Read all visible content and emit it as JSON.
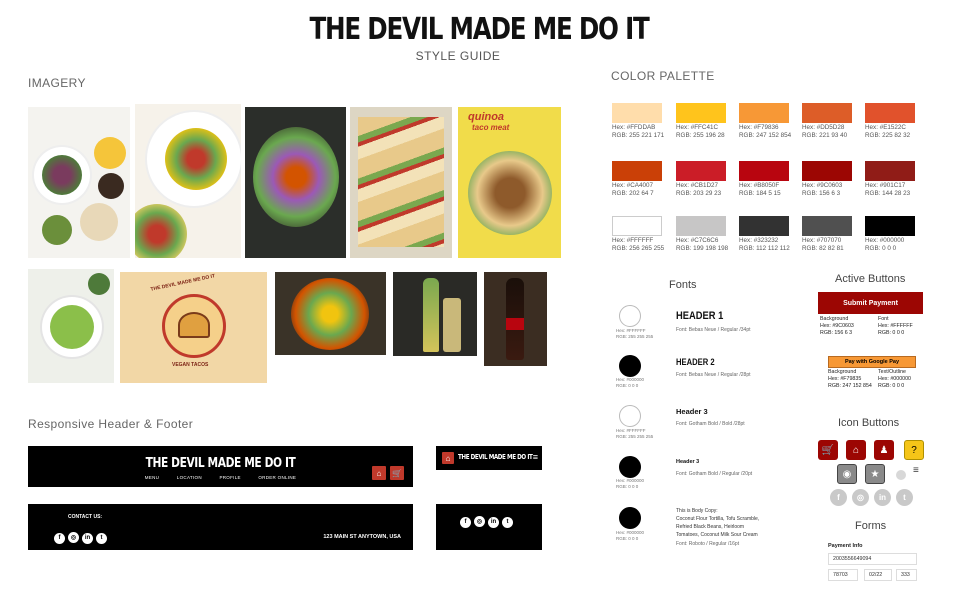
{
  "page": {
    "title": "THE DEVIL MADE ME DO IT",
    "subtitle": "STYLE GUIDE"
  },
  "sections": {
    "imagery": "IMAGERY",
    "responsive": "Responsive Header & Footer",
    "palette": "COLOR PALETTE",
    "fonts": "Fonts",
    "active_buttons": "Active Buttons",
    "icon_buttons": "Icon Buttons",
    "forms": "Forms"
  },
  "imagery": {
    "poster_text_1": "quinoa",
    "poster_text_2": "taco meat",
    "logo_text": "THE DEVIL MADE ME DO IT",
    "logo_sub": "VEGAN TACOS"
  },
  "header_bar": {
    "title": "THE DEVIL MADE ME DO IT",
    "nav": [
      "MENU",
      "LOCATION",
      "PROFILE",
      "ORDER ONLINE"
    ],
    "home_icon": "home-icon",
    "cart_icon": "cart-icon"
  },
  "mobile_header": {
    "title": "THE DEVIL MADE ME DO IT",
    "menu_icon": "hamburger-icon"
  },
  "footer_bar": {
    "contact_label": "CONTACT US:",
    "address": "123 MAIN ST ANYTOWN, USA",
    "social": [
      "f",
      "ig",
      "in",
      "tw"
    ]
  },
  "palette": [
    {
      "hex": "Hex: #FFDDAB",
      "rgb": "RGB: 255 221 171",
      "color": "#FFDDAB"
    },
    {
      "hex": "Hex: #FFC41C",
      "rgb": "RGB: 255 196 28",
      "color": "#FFC41C"
    },
    {
      "hex": "Hex: #F79836",
      "rgb": "RGB: 247 152 854",
      "color": "#F79836"
    },
    {
      "hex": "Hex: #DD5D28",
      "rgb": "RGB: 221 93 40",
      "color": "#DD5D28"
    },
    {
      "hex": "Hex: #E1522C",
      "rgb": "RGB: 225 82 32",
      "color": "#E1522C"
    },
    {
      "hex": "Hex: #CA4007",
      "rgb": "RGB: 202 64 7",
      "color": "#CA4007"
    },
    {
      "hex": "Hex: #CB1D27",
      "rgb": "RGB: 203 29 23",
      "color": "#CB1D27"
    },
    {
      "hex": "Hex: #B8050F",
      "rgb": "RGB: 184 5 15",
      "color": "#B8050F"
    },
    {
      "hex": "Hex: #9C0603",
      "rgb": "RGB: 156 6 3",
      "color": "#9C0603"
    },
    {
      "hex": "Hex: #901C17",
      "rgb": "RGB: 144 28 23",
      "color": "#901C17"
    },
    {
      "hex": "Hex: #FFFFFF",
      "rgb": "RGB: 256 265 255",
      "color": "#FFFFFF"
    },
    {
      "hex": "Hex: #C7C6C6",
      "rgb": "RGB: 199 198 198",
      "color": "#C7C6C6"
    },
    {
      "hex": "Hex: #323232",
      "rgb": "RGB: 112 112 112",
      "color": "#323232"
    },
    {
      "hex": "Hex: #707070",
      "rgb": "RGB: 82 82 81",
      "color": "#505050"
    },
    {
      "hex": "Hex: #000000",
      "rgb": "RGB: 0 0 0",
      "color": "#000000"
    }
  ],
  "fonts": [
    {
      "name": "HEADER 1",
      "desc": "Font: Bebas Neue / Regular /34pt",
      "swatch_hex": "Hex: #FFFFFF",
      "swatch_rgb": "RGB: 255 255 255",
      "swatch": "#FFFFFF"
    },
    {
      "name": "HEADER 2",
      "desc": "Font: Bebas Neue / Regular /28pt",
      "swatch_hex": "Hex: #000000",
      "swatch_rgb": "RGB: 0 0 0",
      "swatch": "#000000"
    },
    {
      "name": "Header 3",
      "desc": "Font: Gotham Bold / Bold /28pt",
      "swatch_hex": "Hex: #FFFFFF",
      "swatch_rgb": "RGB: 255 255 255",
      "swatch": "#FFFFFF"
    },
    {
      "name": "Header 3",
      "desc": "Font: Gotham Bold / Regular /20pt",
      "swatch_hex": "Hex: #000000",
      "swatch_rgb": "RGB: 0 0 0",
      "swatch": "#000000"
    }
  ],
  "body_copy": {
    "lines": [
      "This is Body Copy:",
      "Coconut Flour Tortilla, Tofu Scramble,",
      "Refried Black Beans, Heirloom",
      "Tomatoes, Coconut Milk Sour Cream"
    ],
    "font": "Font: Roboto / Regular /16pt",
    "swatch_hex": "Hex: #000000",
    "swatch_rgb": "RGB: 0 0 0"
  },
  "active_buttons": {
    "submit": {
      "label": "Submit Payment",
      "bg_label": "Background",
      "bg_hex": "Hex: #9C0603",
      "bg_rgb": "RGB: 156 6 3",
      "font_label": "Font",
      "font_hex": "Hex: #FFFFFF",
      "font_rgb": "RGB: 0 0 0"
    },
    "google": {
      "label": "Pay with Google Pay",
      "bg_label": "Background",
      "bg_hex": "Hex: #F79835",
      "bg_rgb": "RGB: 247 152 854",
      "font_label": "Text/Outline",
      "font_hex": "Hex: #000000",
      "font_rgb": "RGB: 0 0 0"
    }
  },
  "icon_buttons": {
    "row1": [
      "cart-icon",
      "home-icon",
      "user-icon",
      "help-icon"
    ],
    "row2": [
      "globe-icon",
      "star-icon",
      "dot-icon",
      "menu-icon"
    ],
    "social": [
      "f",
      "ig",
      "in",
      "tw"
    ]
  },
  "forms": {
    "label": "Payment Info",
    "card_number": "2003556649094",
    "zip": "78703",
    "expiry": "02/22",
    "cvv": "333"
  }
}
